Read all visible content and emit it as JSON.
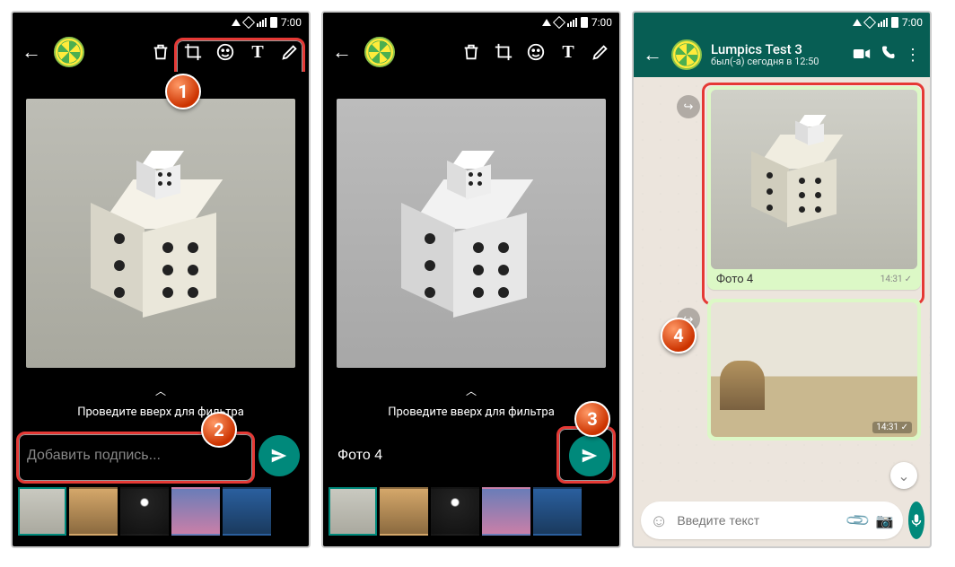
{
  "status": {
    "time": "7:00"
  },
  "editor": {
    "filter_hint": "Проведите вверх для фильтра",
    "caption_placeholder": "Добавить подпись...",
    "caption_value": "Фото 4"
  },
  "chat": {
    "contact_name": "Lumpics Test 3",
    "last_seen": "был(-а) сегодня в 12:50",
    "msg1_caption": "Фото 4",
    "msg1_time": "14:31",
    "msg2_time": "14:31",
    "input_placeholder": "Введите текст"
  },
  "badges": {
    "b1": "1",
    "b2": "2",
    "b3": "3",
    "b4": "4"
  }
}
